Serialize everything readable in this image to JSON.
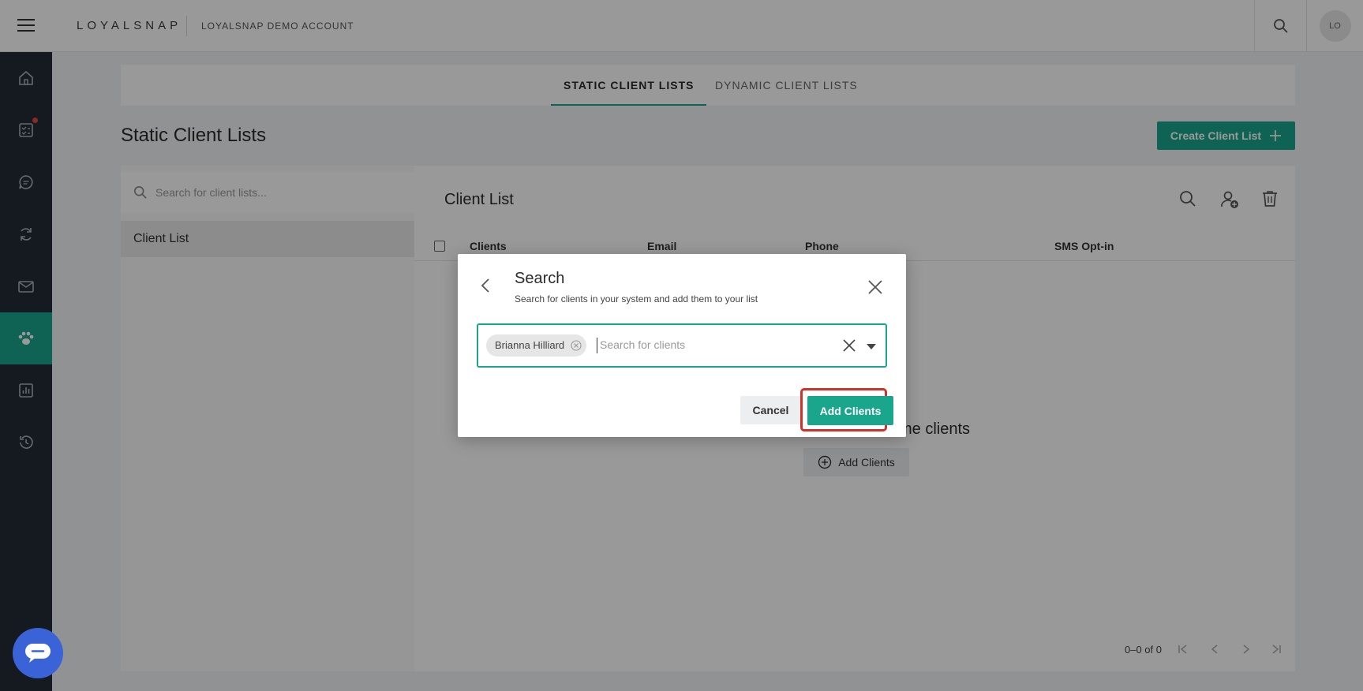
{
  "header": {
    "logo": "LOYALSNAP",
    "account": "LOYALSNAP DEMO ACCOUNT",
    "avatar_initials": "LO",
    "icons": [
      "hamburger-icon",
      "search-icon"
    ]
  },
  "sidebar": {
    "items": [
      {
        "icon": "home-icon",
        "active": false
      },
      {
        "icon": "checklist-icon",
        "active": false,
        "notification": true
      },
      {
        "icon": "chat-icon",
        "active": false
      },
      {
        "icon": "sync-icon",
        "active": false
      },
      {
        "icon": "mail-icon",
        "active": false
      },
      {
        "icon": "paw-icon",
        "active": true
      },
      {
        "icon": "chart-icon",
        "active": false
      },
      {
        "icon": "history-icon",
        "active": false
      }
    ],
    "chat_widget_icon": "chat-bubble-icon"
  },
  "tabs": [
    {
      "label": "STATIC CLIENT LISTS",
      "active": true
    },
    {
      "label": "DYNAMIC CLIENT LISTS",
      "active": false
    }
  ],
  "page": {
    "title": "Static Client Lists",
    "create_button": "Create Client List"
  },
  "left_pane": {
    "search_placeholder": "Search for client lists...",
    "items": [
      "Client List"
    ]
  },
  "right_pane": {
    "title": "Client List",
    "columns": [
      "Clients",
      "Email",
      "Phone",
      "SMS Opt-in"
    ],
    "empty_text": "me clients",
    "empty_add_button": "Add Clients",
    "pagination": "0–0 of 0",
    "toolbar_icons": [
      "search-icon",
      "add-user-icon",
      "trash-icon"
    ]
  },
  "modal": {
    "title": "Search",
    "subtitle": "Search for clients in your system and add them to your list",
    "chip": "Brianna Hilliard",
    "placeholder": "Search for clients",
    "cancel": "Cancel",
    "add": "Add Clients"
  },
  "colors": {
    "accent": "#1aa58d",
    "sidebar": "#232b36",
    "highlight": "#d2312a",
    "chat_widget": "#3a63d8"
  }
}
